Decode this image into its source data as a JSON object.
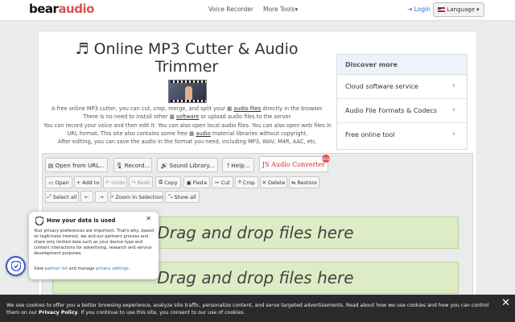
{
  "nav": {
    "logo_bear": "bear",
    "logo_audio": "audio",
    "voice_recorder": "Voice Recorder",
    "more_tools": "More Tools",
    "login": "Login",
    "language": "Language"
  },
  "page": {
    "title": "Online MP3 Cutter & Audio Trimmer",
    "desc_1a": "A free online MP3 cutter, you can cut, crop, merge, and split your",
    "desc_1b": "audio files",
    "desc_1c": "directly in the browser.",
    "desc_2a": "There is no need to install other",
    "desc_2b": "software",
    "desc_2c": "or upload audio files to the server.",
    "desc_3": "You can record your voice and then edit it. You can also open local audio files. You can also open web files in URL format. This site also contains some free",
    "desc_3b": "audio",
    "desc_3c": "material libraries without copyright.",
    "desc_4": "After editing, you can save the audio in the format you need, including MP3, WAV, M4R, AAC, etc."
  },
  "discover": {
    "header": "Discover more",
    "items": [
      {
        "label": "Cloud software service"
      },
      {
        "label": "Audio File Formats & Codecs"
      },
      {
        "label": "Free online tool"
      }
    ]
  },
  "toolbar": {
    "open_url": "Open from URL...",
    "record": "Record...",
    "sound_library": "Sound Library...",
    "help": "Help...",
    "js_converter_js": "JS",
    "js_converter_text": "Audio Converter",
    "open": "Open",
    "add_to": "Add to",
    "undo": "Undo",
    "redo": "Redo",
    "copy": "Copy",
    "paste": "Paste",
    "cut": "Cut",
    "crop": "Crop",
    "delete": "Delete",
    "restore": "Restore",
    "select_all": "Select all",
    "prev": "←",
    "next": "→",
    "zoom_selection": "Zoom in Selection",
    "show_all": "Show all"
  },
  "dropzones": [
    {
      "label": "Drag and drop files here"
    },
    {
      "label": "Drag and drop files here"
    }
  ],
  "privacy": {
    "title": "How your data is used",
    "body": "Your privacy preferences are important. That's why, based on legitimate interest, we and our partners process and share only limited data such as your device type and content interactions for advertising, research and service development purposes.",
    "view": "View",
    "partner_list": "partner list",
    "and_manage": "and manage",
    "privacy_settings": "privacy settings."
  },
  "cookie": {
    "text_a": "We use cookies to offer you a better browsing experience, analyze site traffic, personalize content, and serve targeted advertisements. Read about how we use cookies and how you can control them on our",
    "policy": "Privacy Policy",
    "text_b": ". If you continue to use this site, you consent to our use of cookies."
  },
  "colors": {
    "brand_red": "#d9534f",
    "link_blue": "#2a6fdb",
    "dropzone_green": "#ddecc4",
    "cookie_bg": "#2a2a2a"
  }
}
